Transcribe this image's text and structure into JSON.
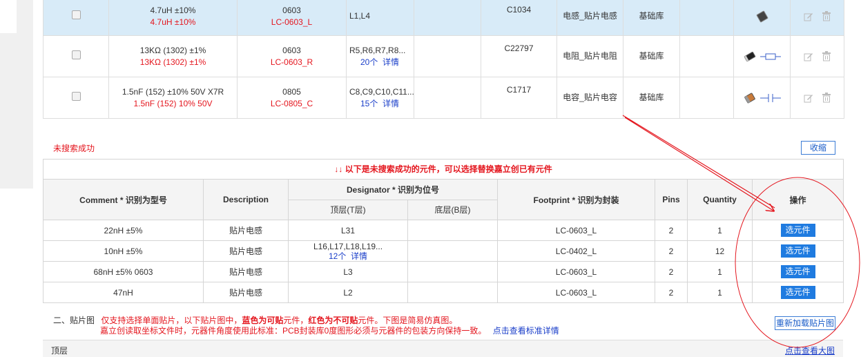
{
  "top_rows": [
    {
      "comment": "4.7uH ±10%",
      "comment_match": "4.7uH ±10%",
      "package": "0603",
      "package_match": "LC-0603_L",
      "designator": "L1,L4",
      "count": "",
      "detail": "",
      "code": "C1034",
      "category": "电感_贴片电感",
      "library": "基础库",
      "chip": "inductor",
      "highlight": true
    },
    {
      "comment": "13KΩ (1302) ±1%",
      "comment_match": "13KΩ (1302) ±1%",
      "package": "0603",
      "package_match": "LC-0603_R",
      "designator": "R5,R6,R7,R8...",
      "count": "20个",
      "detail": "详情",
      "code": "C22797",
      "category": "电阻_贴片电阻",
      "library": "基础库",
      "chip": "resistor",
      "highlight": false
    },
    {
      "comment": "1.5nF (152) ±10% 50V X7R",
      "comment_match": "1.5nF (152) 10% 50V",
      "package": "0805",
      "package_match": "LC-0805_C",
      "designator": "C8,C9,C10,C11...",
      "count": "15个",
      "detail": "详情",
      "code": "C1717",
      "category": "电容_贴片电容",
      "library": "基础库",
      "chip": "capacitor",
      "highlight": false
    }
  ],
  "fail_title": "未搜索成功",
  "collapse_label": "收缩",
  "notice": "↓↓ 以下是未搜索成功的元件，可以选择替换嘉立创已有元件",
  "headers": {
    "comment": "Comment * 识别为型号",
    "description": "Description",
    "designator": "Designator * 识别为位号",
    "top_layer": "顶层(T层)",
    "bottom_layer": "底层(B层)",
    "footprint": "Footprint * 识别为封装",
    "pins": "Pins",
    "quantity": "Quantity",
    "action": "操作"
  },
  "fail_rows": [
    {
      "comment": "22nH ±5%",
      "description": "贴片电感",
      "top": "L31",
      "count": "",
      "detail": "",
      "bottom": "",
      "footprint": "LC-0603_L",
      "pins": "2",
      "quantity": "1",
      "button": "选元件"
    },
    {
      "comment": "10nH ±5%",
      "description": "贴片电感",
      "top": "L16,L17,L18,L19...",
      "count": "12个",
      "detail": "详情",
      "bottom": "",
      "footprint": "LC-0402_L",
      "pins": "2",
      "quantity": "12",
      "button": "选元件"
    },
    {
      "comment": "68nH ±5% 0603",
      "description": "贴片电感",
      "top": "L3",
      "count": "",
      "detail": "",
      "bottom": "",
      "footprint": "LC-0603_L",
      "pins": "2",
      "quantity": "1",
      "button": "选元件"
    },
    {
      "comment": "47nH",
      "description": "贴片电感",
      "top": "L2",
      "count": "",
      "detail": "",
      "bottom": "",
      "footprint": "LC-0603_L",
      "pins": "2",
      "quantity": "1",
      "button": "选元件"
    }
  ],
  "section2": {
    "title": "二、贴片图",
    "note_a": "仅支持选择单面贴片，以下贴片图中，",
    "note_blue": "蓝色为可贴",
    "note_b": "元件，",
    "note_red": "红色为不可贴",
    "note_c": "元件。下图是简易仿真图。",
    "line2": "嘉立创读取坐标文件时，元器件角度使用此标准：PCB封装库0度图形必须与元器件的包装方向保持一致。",
    "line2_link": "点击查看标准详情",
    "reload_label": "重新加载贴片图"
  },
  "toplayer": {
    "label": "顶层",
    "link": "点击查看大图"
  },
  "colors": {
    "red": "#e4161e",
    "blue": "#1a3ec9",
    "button": "#1f7be0",
    "highlight_row": "#d8ebf8"
  }
}
